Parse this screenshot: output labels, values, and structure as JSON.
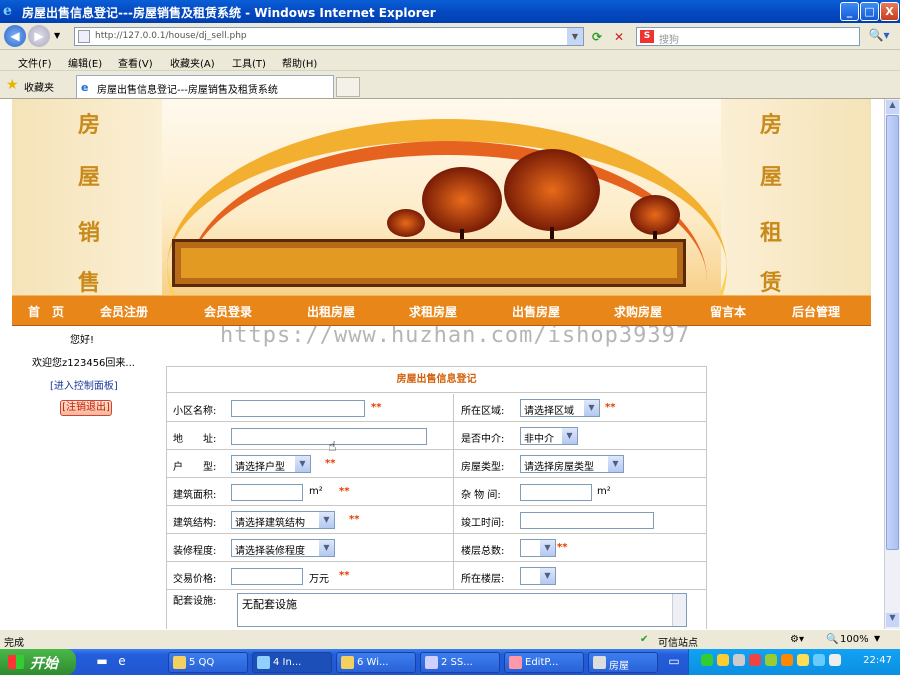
{
  "window": {
    "title": "房屋出售信息登记---房屋销售及租赁系统 - Windows Internet Explorer",
    "controls": {
      "minimize": "_",
      "maximize": "□",
      "close": "X"
    }
  },
  "address_bar": {
    "url": "http://127.0.0.1/house/dj_sell.php",
    "search_placeholder": "搜狗"
  },
  "menu": [
    "文件(F)",
    "编辑(E)",
    "查看(V)",
    "收藏夹(A)",
    "工具(T)",
    "帮助(H)"
  ],
  "favorites": {
    "label": "收藏夹",
    "tab_title": "房屋出售信息登记---房屋销售及租赁系统"
  },
  "banner": {
    "left_chars": [
      "房",
      "屋",
      "销",
      "售"
    ],
    "right_chars": [
      "房",
      "屋",
      "租",
      "赁"
    ]
  },
  "nav": [
    "首　页",
    "会员注册",
    "会员登录",
    "出租房屋",
    "求租房屋",
    "出售房屋",
    "求购房屋",
    "留言本",
    "后台管理"
  ],
  "sidebar": {
    "greeting": "您好!",
    "welcome": "欢迎您z123456回来...",
    "control_panel": "[进入控制面板]",
    "logout": "[注销退出]"
  },
  "watermark": "https://www.huzhan.com/ishop39397",
  "form": {
    "title": "房屋出售信息登记",
    "required_mark": "**",
    "labels": {
      "community": "小区名称:",
      "district": "所在区域:",
      "address": "地　　址:",
      "agency": "是否中介:",
      "layout": "户　　型:",
      "house_type": "房屋类型:",
      "area": "建筑面积:",
      "storage": "杂 物 间:",
      "structure": "建筑结构:",
      "completion": "竣工时间:",
      "decoration": "装修程度:",
      "total_floors": "楼层总数:",
      "price": "交易价格:",
      "floor": "所在楼层:",
      "facilities": "配套设施:"
    },
    "values": {
      "district": "请选择区域",
      "agency": "非中介",
      "layout": "请选择户型",
      "house_type": "请选择房屋类型",
      "structure": "请选择建筑结构",
      "decoration": "请选择装修程度",
      "total_floors": "",
      "floor": "",
      "facilities": "无配套设施"
    },
    "units": {
      "area": "m²",
      "storage": "m²",
      "price": "万元"
    }
  },
  "status": {
    "text": "完成",
    "zone": "可信站点",
    "zoom": "100%"
  },
  "taskbar": {
    "start": "开始",
    "tasks": [
      "5 QQ",
      "4 In...",
      "6 Wi...",
      "2 SS...",
      "EditP...",
      "房屋"
    ],
    "clock": "22:47"
  }
}
